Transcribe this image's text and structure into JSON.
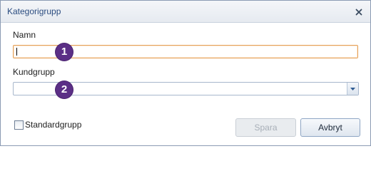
{
  "dialog": {
    "title": "Kategorigrupp"
  },
  "form": {
    "name_label": "Namn",
    "name_value": "",
    "customer_group_label": "Kundgrupp",
    "customer_group_value": "",
    "standard_group_label": "Standardgrupp",
    "standard_group_checked": false
  },
  "buttons": {
    "save_label": "Spara",
    "save_enabled": false,
    "cancel_label": "Avbryt"
  },
  "callouts": [
    "1",
    "2"
  ],
  "colors": {
    "title_text": "#2b4c80",
    "callout_fill": "#5b2f86",
    "focused_input_border": "#e5a25b"
  },
  "icons": {
    "close": "close-icon",
    "dropdown": "chevron-down-icon"
  }
}
